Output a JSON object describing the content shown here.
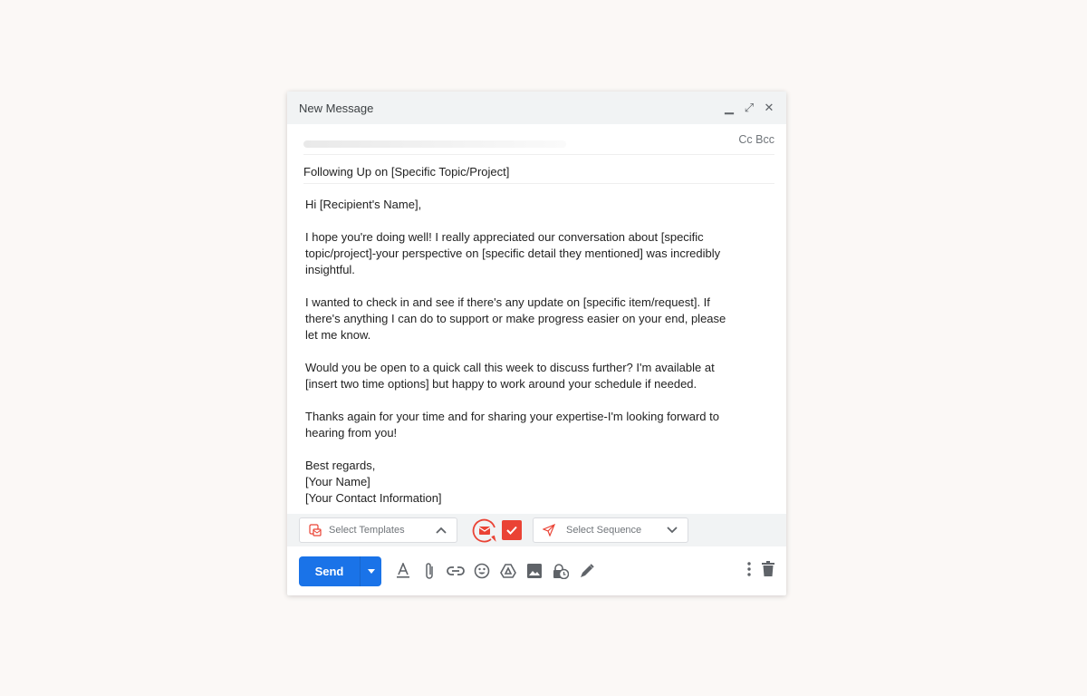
{
  "window": {
    "title": "New Message",
    "controls": [
      "minimize",
      "fullscreen",
      "close"
    ]
  },
  "recipients": {
    "cc_bcc": "Cc Bcc"
  },
  "subject": "Following Up on [Specific Topic/Project]",
  "body": [
    [
      "Hi [Recipient's Name],"
    ],
    [
      "I hope you're doing well! I really appreciated our conversation about [specific",
      "topic/project]-your perspective on [specific detail they mentioned] was incredibly",
      "insightful."
    ],
    [
      "I wanted to check in and see if there's any update on [specific item/request]. If",
      "there's anything I can do to support or make progress easier on your end, please",
      "let me know."
    ],
    [
      "Would you be open to a quick call this week to discuss further? I'm available at",
      "[insert two time options] but happy to work around your schedule if needed."
    ],
    [
      "Thanks again for your time and for sharing your expertise-I'm looking forward to",
      "hearing from you!"
    ],
    [
      "Best regards,",
      "[Your Name]",
      "[Your Contact Information]"
    ]
  ],
  "extension": {
    "templates_placeholder": "Select Templates",
    "sequence_placeholder": "Select Sequence",
    "accent": "#ea4335"
  },
  "toolbar": {
    "send_label": "Send",
    "primary": "#1a73e8"
  }
}
